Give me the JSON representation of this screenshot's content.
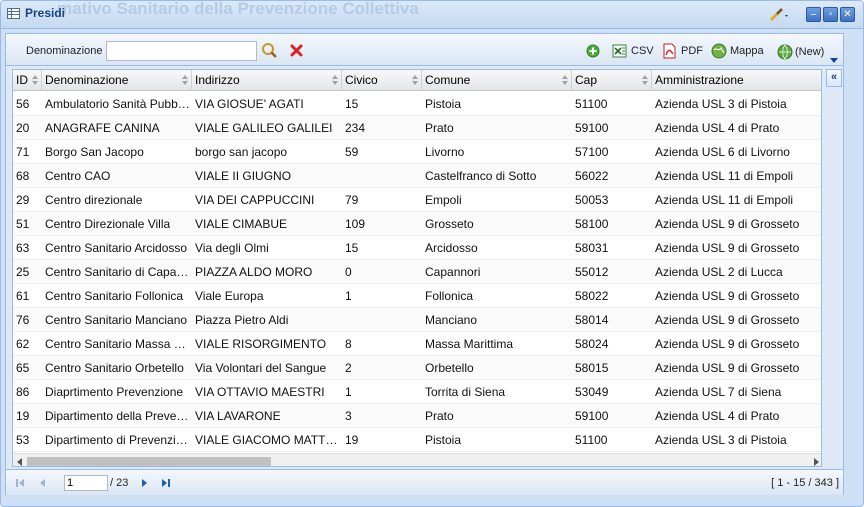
{
  "window": {
    "title": "Presidi",
    "background_title": "mativo Sanitario della Prevenzione Collettiva",
    "accent": "#15428b"
  },
  "toolbar": {
    "search_label": "Denominazione",
    "search_value": "",
    "csv_label": "CSV",
    "pdf_label": "PDF",
    "map_label": "Mappa",
    "new_label": "(New)"
  },
  "grid": {
    "columns": [
      "ID",
      "Denominazione",
      "Indirizzo",
      "Civico",
      "Comune",
      "Cap",
      "Amministrazione"
    ],
    "rows": [
      [
        "56",
        "Ambulatorio Sanità Pubblica",
        "VIA GIOSUE' AGATI",
        "15",
        "Pistoia",
        "51100",
        "Azienda USL 3 di Pistoia"
      ],
      [
        "20",
        "ANAGRAFE CANINA",
        "VIALE GALILEO GALILEI",
        "234",
        "Prato",
        "59100",
        "Azienda USL 4 di Prato"
      ],
      [
        "71",
        "Borgo San Jacopo",
        "borgo san jacopo",
        "59",
        "Livorno",
        "57100",
        "Azienda USL 6 di Livorno"
      ],
      [
        "68",
        "Centro CAO",
        "VIALE II GIUGNO",
        "",
        "Castelfranco di Sotto",
        "56022",
        "Azienda USL 11 di Empoli"
      ],
      [
        "29",
        "Centro direzionale",
        "VIA DEI CAPPUCCINI",
        "79",
        "Empoli",
        "50053",
        "Azienda USL 11 di Empoli"
      ],
      [
        "51",
        "Centro Direzionale Villa",
        "VIALE CIMABUE",
        "109",
        "Grosseto",
        "58100",
        "Azienda USL 9 di Grosseto"
      ],
      [
        "63",
        "Centro Sanitario Arcidosso",
        "Via degli Olmi",
        "15",
        "Arcidosso",
        "58031",
        "Azienda USL 9 di Grosseto"
      ],
      [
        "25",
        "Centro Sanitario di Capannori",
        "PIAZZA ALDO MORO",
        "0",
        "Capannori",
        "55012",
        "Azienda USL 2 di Lucca"
      ],
      [
        "61",
        "Centro Sanitario Follonica",
        "Viale Europa",
        "1",
        "Follonica",
        "58022",
        "Azienda USL 9 di Grosseto"
      ],
      [
        "76",
        "Centro Sanitario Manciano",
        "Piazza Pietro Aldi",
        "",
        "Manciano",
        "58014",
        "Azienda USL 9 di Grosseto"
      ],
      [
        "62",
        "Centro Sanitario Massa Marittima",
        "VIALE RISORGIMENTO",
        "8",
        "Massa Marittima",
        "58024",
        "Azienda USL 9 di Grosseto"
      ],
      [
        "65",
        "Centro Sanitario Orbetello",
        "Via Volontari del Sangue",
        "2",
        "Orbetello",
        "58015",
        "Azienda USL 9 di Grosseto"
      ],
      [
        "86",
        "Diaprtimento Prevenzione",
        "VIA OTTAVIO MAESTRI",
        "1",
        "Torrita di Siena",
        "53049",
        "Azienda USL 7 di Siena"
      ],
      [
        "19",
        "Dipartimento della Prevenzione",
        "VIA LAVARONE",
        "3",
        "Prato",
        "59100",
        "Azienda USL 4 di Prato"
      ],
      [
        "53",
        "Dipartimento di Prevenzione",
        "VIALE GIACOMO MATTEOTTI",
        "19",
        "Pistoia",
        "51100",
        "Azienda USL 3 di Pistoia"
      ]
    ]
  },
  "pager": {
    "page": "1",
    "of_total": "/ 23",
    "info": "[ 1 - 15 / 343 ]"
  }
}
